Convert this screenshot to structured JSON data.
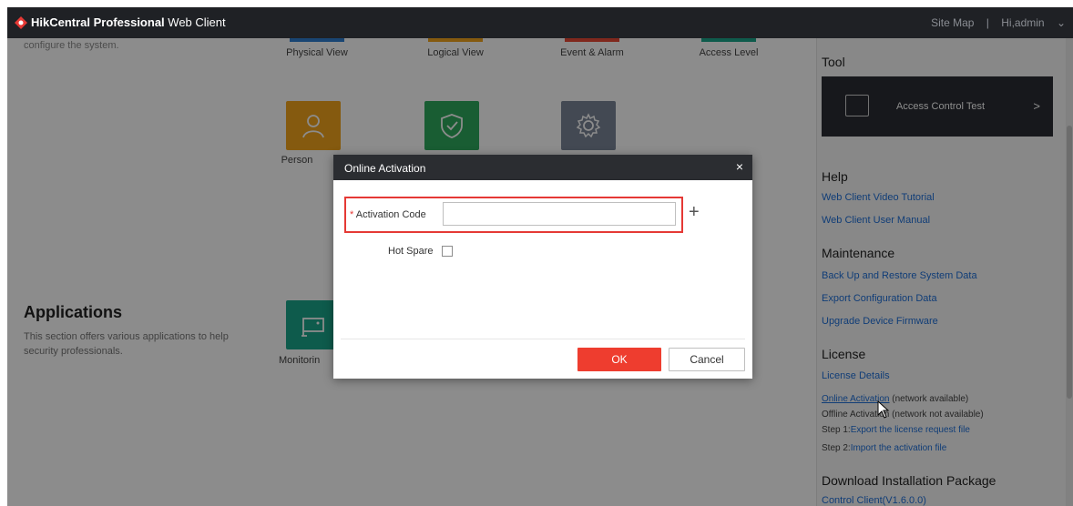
{
  "header": {
    "brand": "HikCentral Professional",
    "brand_suffix": "Web Client",
    "site_map": "Site Map",
    "separator": "|",
    "user": "Hi,admin"
  },
  "background": {
    "cut_text": "configure the system.",
    "tiles_top": [
      {
        "label": "Physical View",
        "color": "#2f7fd1"
      },
      {
        "label": "Logical View",
        "color": "#f2a41d"
      },
      {
        "label": "Event & Alarm",
        "color": "#e94a35"
      },
      {
        "label": "Access Level",
        "color": "#1aa78a"
      }
    ],
    "tiles_mid": [
      {
        "label": "Person",
        "color": "#f2a41d",
        "icon": "person-icon"
      },
      {
        "label": "",
        "color": "#2faa5d",
        "icon": "shield-check-icon"
      },
      {
        "label": "",
        "color": "#7a8597",
        "icon": "gear-icon"
      }
    ],
    "monitoring_label": "Monitorin",
    "applications_title": "Applications",
    "applications_desc": "This section offers various applications to help security professionals."
  },
  "right_panel": {
    "tool_heading": "Tool",
    "tool_card_label": "Access Control Test",
    "tool_card_arrow": ">",
    "help_heading": "Help",
    "help_links": [
      "Web Client Video Tutorial",
      "Web Client User Manual"
    ],
    "maintenance_heading": "Maintenance",
    "maintenance_links": [
      "Back Up and Restore System Data",
      "Export Configuration Data",
      "Upgrade Device Firmware"
    ],
    "license_heading": "License",
    "license_details": "License Details",
    "online_activation_link": "Online Activation",
    "online_activation_note": "(network available)",
    "offline_activation": "Offline Activation (network not available)",
    "step1_prefix": "Step 1:",
    "step1_link": "Export the license request file",
    "step2_prefix": "Step 2:",
    "step2_link": "Import the activation file",
    "download_heading": "Download Installation Package",
    "download_link": "Control Client(V1.6.0.0)"
  },
  "dialog": {
    "title": "Online Activation",
    "close": "×",
    "required_mark": "*",
    "code_label": "Activation Code",
    "code_value": "",
    "code_placeholder": "",
    "plus": "+",
    "hot_spare_label": "Hot Spare",
    "hot_spare_checked": false,
    "ok_label": "OK",
    "cancel_label": "Cancel"
  }
}
